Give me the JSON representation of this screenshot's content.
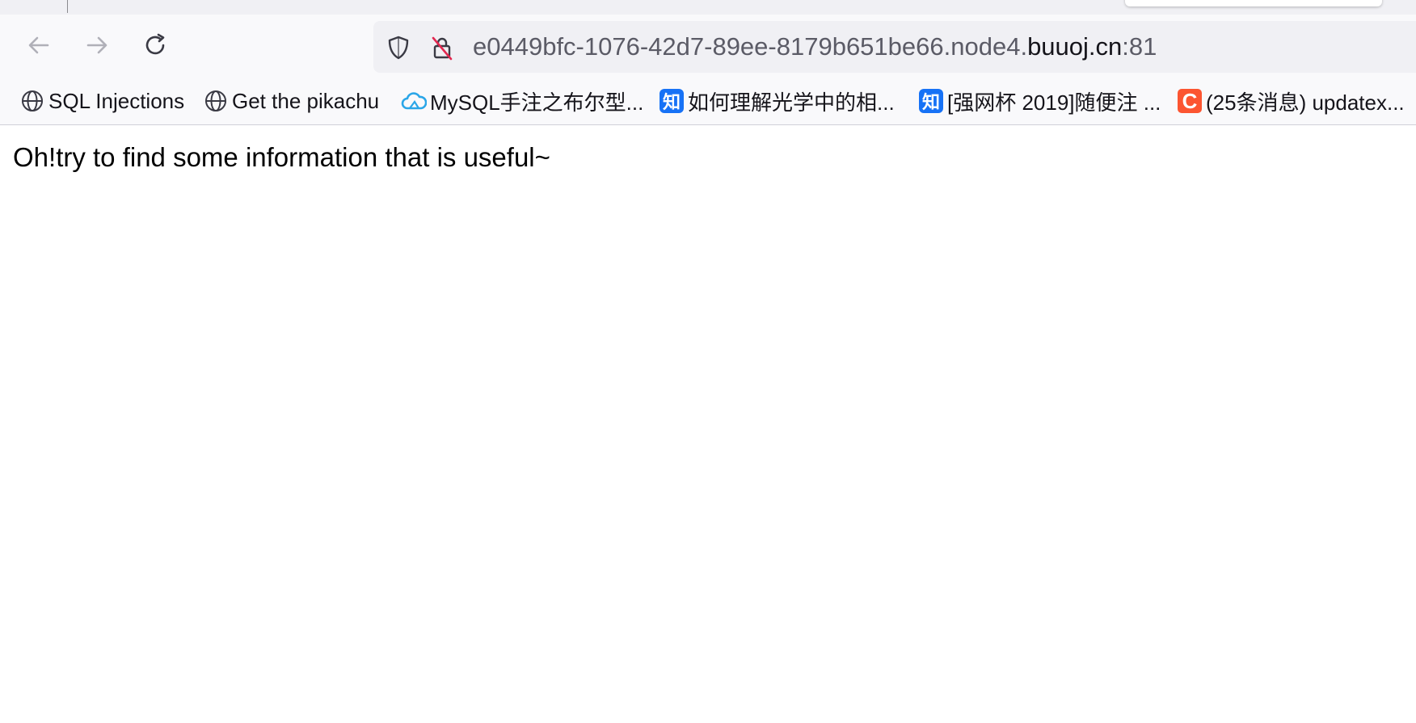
{
  "browser": {
    "url": {
      "prefix": "e0449bfc-1076-42d7-89ee-8179b651be66.node4.",
      "host": "buuoj.cn",
      "port": ":81"
    },
    "icons": {
      "back": "arrow-left-icon",
      "forward": "arrow-right-icon",
      "reload": "reload-icon",
      "tracking_protection": "shield-icon",
      "connection": "insecure-lock-icon"
    },
    "bookmarks": [
      {
        "label": "SQL Injections",
        "icon": "globe-icon"
      },
      {
        "label": "Get the pikachu",
        "icon": "globe-icon"
      },
      {
        "label": "MySQL手注之布尔型...",
        "icon": "cloud-icon"
      },
      {
        "label": "如何理解光学中的相...",
        "icon": "zhihu-icon",
        "icon_text": "知"
      },
      {
        "label": "[强网杯 2019]随便注 ...",
        "icon": "zhihu-icon",
        "icon_text": "知"
      },
      {
        "label": "(25条消息) updatex...",
        "icon": "csdn-icon",
        "icon_text": "C"
      }
    ]
  },
  "page": {
    "text": "Oh!try to find some information that is useful~"
  },
  "colors": {
    "toolbar": "#f9f9fb",
    "urlbar": "#f0f0f4",
    "zhihu": "#1772f6",
    "csdn": "#fc5531",
    "cloud": "#2aa6e8"
  }
}
